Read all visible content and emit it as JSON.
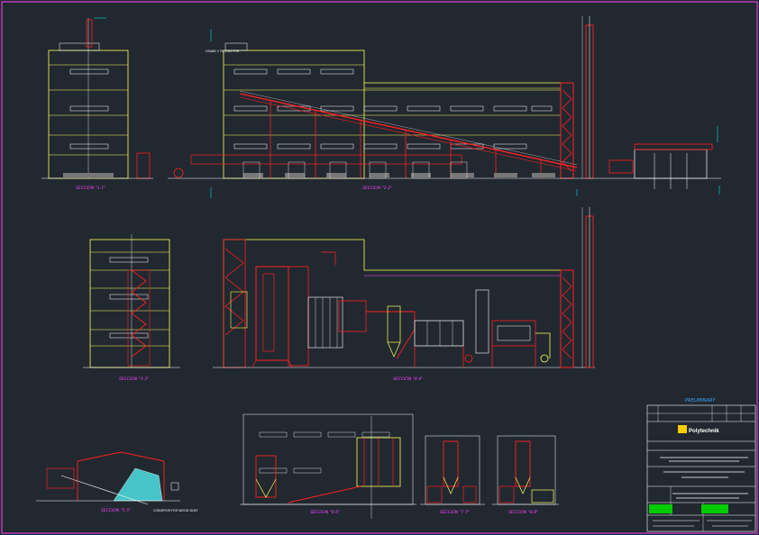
{
  "drawing": {
    "colors": {
      "background": "#212830",
      "frame": "#ff44ff",
      "building_outline": "#ffff55",
      "steel": "#ff2020",
      "dimension": "#00ffff",
      "text": "#ffffff",
      "title_block": "#ffffff",
      "logo": "#ffcc00",
      "stamp": "#00cc00"
    },
    "views": [
      {
        "id": "section-1-1",
        "label": "SECCION \"1-1\""
      },
      {
        "id": "section-2-2",
        "label": "SECCION \"2-2\""
      },
      {
        "id": "section-3-3",
        "label": "SECCION \"3-3\""
      },
      {
        "id": "section-4-4",
        "label": "SECCION \"4-4\""
      },
      {
        "id": "section-5-5",
        "label": "SECCION \"5-5\""
      },
      {
        "id": "section-6-6",
        "label": "SECCION \"6-6\""
      },
      {
        "id": "section-7-7",
        "label": "SECCION \"7-7\""
      },
      {
        "id": "section-8-8",
        "label": "SECCION \"8-8\""
      }
    ],
    "notes": {
      "crane_note": "CRANE 5 TN,9.65 FOR",
      "conveyor_note": "CONVEYOR FOR WOOD DUST"
    },
    "title_block": {
      "status": "PRELIMINARY",
      "logo_text": "Polytechnik"
    }
  }
}
